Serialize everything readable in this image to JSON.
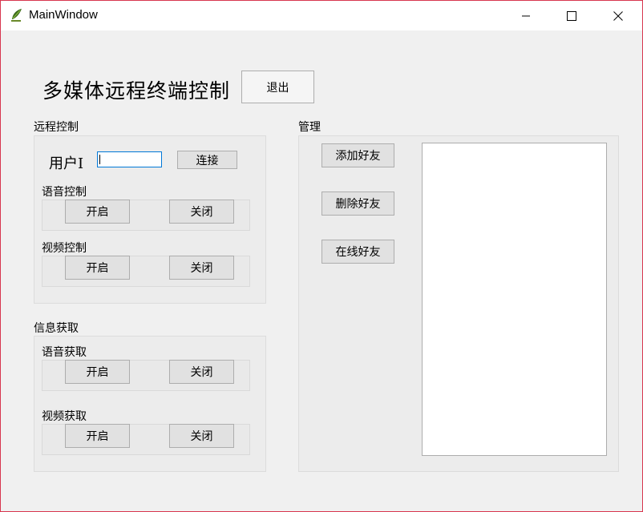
{
  "window": {
    "title": "MainWindow",
    "app_icon": "leaf-icon",
    "controls": {
      "minimize": "minimize-icon",
      "maximize": "maximize-icon",
      "close": "close-icon"
    },
    "border_color": "#d8364f"
  },
  "header": {
    "title": "多媒体远程终端控制",
    "exit_button": "退出"
  },
  "remote_control": {
    "label": "远程控制",
    "user_label": "用户I",
    "user_input": {
      "value": "",
      "placeholder": ""
    },
    "connect_button": "连接",
    "voice": {
      "label": "语音控制",
      "on": "开启",
      "off": "关闭"
    },
    "video": {
      "label": "视频控制",
      "on": "开启",
      "off": "关闭"
    }
  },
  "info_get": {
    "label": "信息获取",
    "voice": {
      "label": "语音获取",
      "on": "开启",
      "off": "关闭"
    },
    "video": {
      "label": "视频获取",
      "on": "开启",
      "off": "关闭"
    }
  },
  "manage": {
    "label": "管理",
    "add_friend": "添加好友",
    "delete_friend": "删除好友",
    "online_friends": "在线好友",
    "friend_list": []
  }
}
